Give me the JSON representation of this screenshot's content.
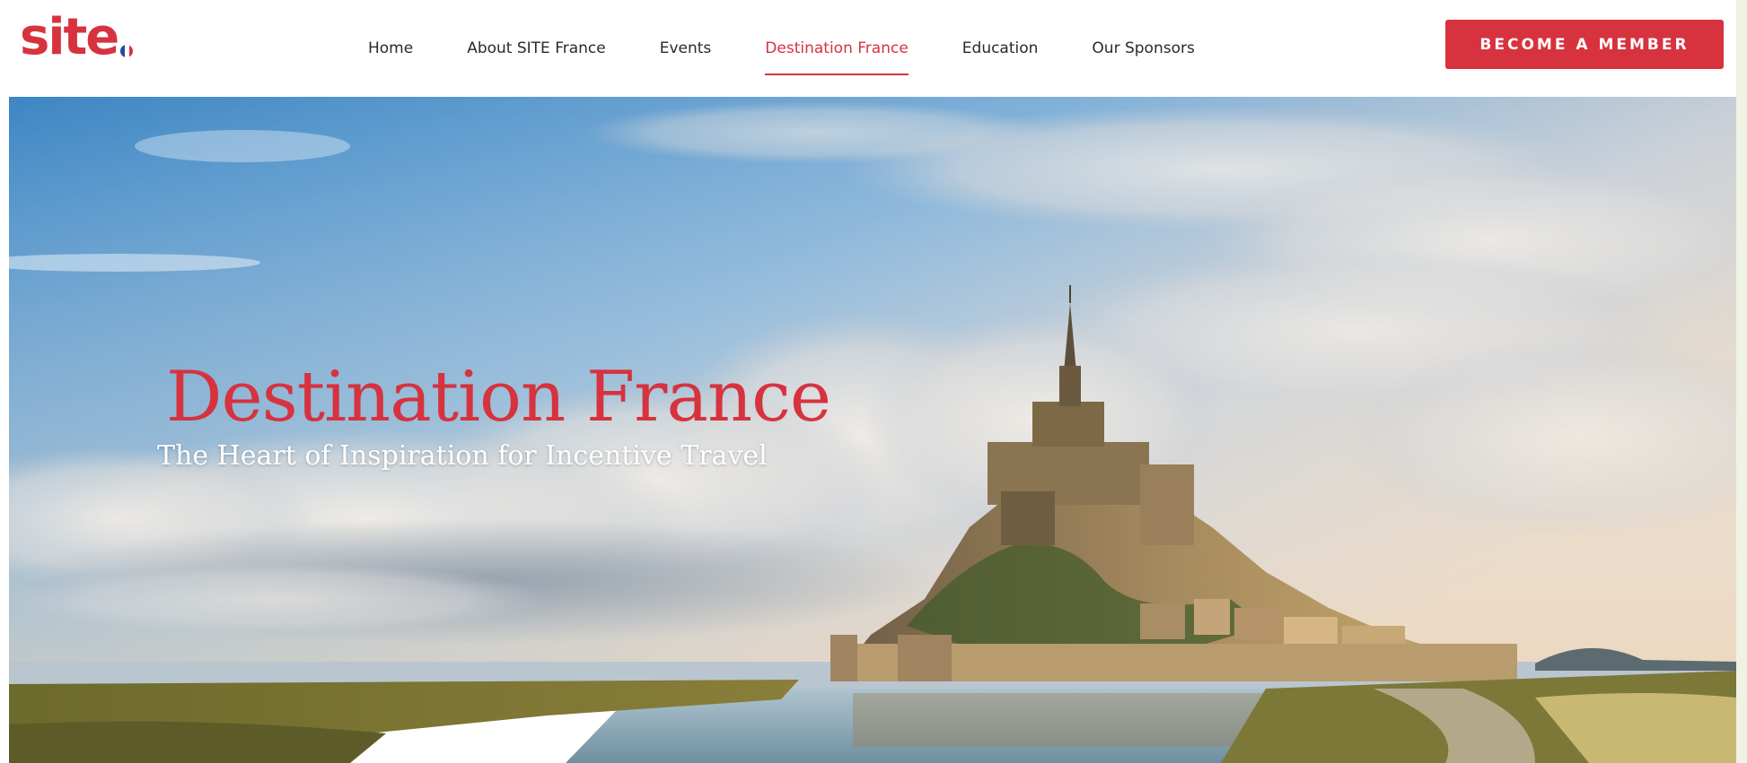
{
  "header": {
    "logo_text": "site",
    "nav": [
      {
        "label": "Home",
        "active": false
      },
      {
        "label": "About SITE France",
        "active": false
      },
      {
        "label": "Events",
        "active": false
      },
      {
        "label": "Destination France",
        "active": true
      },
      {
        "label": "Education",
        "active": false
      },
      {
        "label": "Our Sponsors",
        "active": false
      }
    ],
    "cta_label": "BECOME A MEMBER"
  },
  "hero": {
    "title": "Destination France",
    "subtitle": "The Heart of Inspiration for Incentive Travel",
    "image": "mont-saint-michel-photo"
  },
  "colors": {
    "brand_red": "#d6333f",
    "flag_blue": "#2a4a9a",
    "flag_white": "#ffffff",
    "text_dark": "#2a2a2a"
  },
  "icons": {
    "logo_flag": "french-flag-dot-icon"
  }
}
